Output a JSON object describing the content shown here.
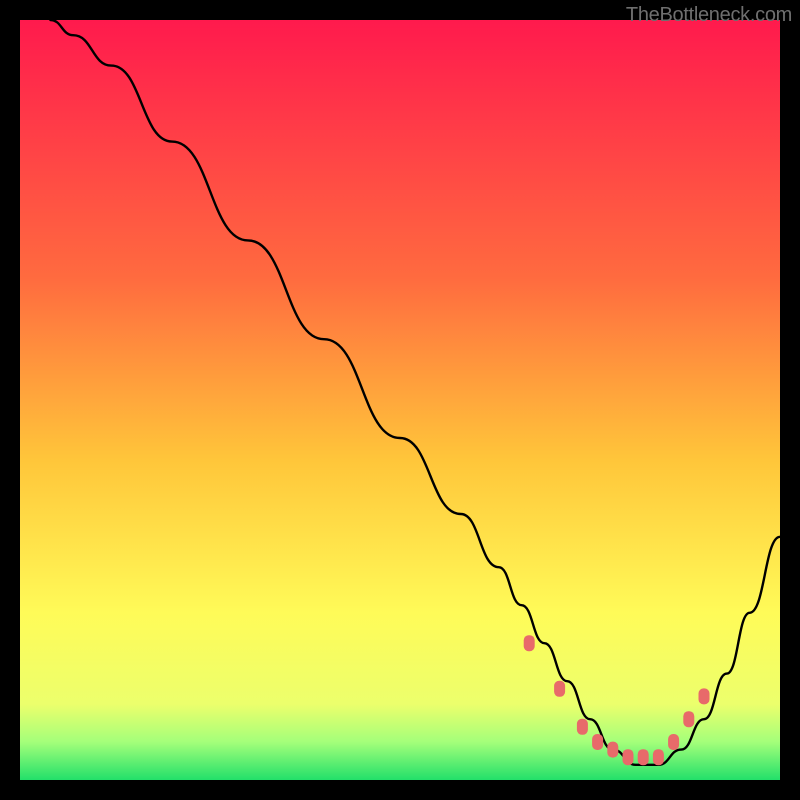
{
  "watermark": "TheBottleneck.com",
  "chart_data": {
    "type": "line",
    "title": "",
    "xlabel": "",
    "ylabel": "",
    "xlim": [
      0,
      100
    ],
    "ylim": [
      0,
      100
    ],
    "gradient_stops": [
      {
        "offset": 0,
        "color": "#ff1a4d"
      },
      {
        "offset": 34,
        "color": "#ff6b3f"
      },
      {
        "offset": 58,
        "color": "#ffc63a"
      },
      {
        "offset": 78,
        "color": "#fffb58"
      },
      {
        "offset": 90,
        "color": "#ecff6c"
      },
      {
        "offset": 95,
        "color": "#a4ff7a"
      },
      {
        "offset": 100,
        "color": "#22e06a"
      }
    ],
    "series": [
      {
        "name": "bottleneck-curve",
        "x": [
          4,
          7,
          12,
          20,
          30,
          40,
          50,
          58,
          63,
          66,
          69,
          72,
          75,
          78,
          81,
          84,
          87,
          90,
          93,
          96,
          100
        ],
        "y": [
          100,
          98,
          94,
          84,
          71,
          58,
          45,
          35,
          28,
          23,
          18,
          13,
          8,
          4,
          2,
          2,
          4,
          8,
          14,
          22,
          32
        ]
      }
    ],
    "markers": {
      "name": "bottleneck-markers",
      "color": "#e86a6a",
      "points": [
        {
          "x": 67,
          "y": 18
        },
        {
          "x": 71,
          "y": 12
        },
        {
          "x": 74,
          "y": 7
        },
        {
          "x": 76,
          "y": 5
        },
        {
          "x": 78,
          "y": 4
        },
        {
          "x": 80,
          "y": 3
        },
        {
          "x": 82,
          "y": 3
        },
        {
          "x": 84,
          "y": 3
        },
        {
          "x": 86,
          "y": 5
        },
        {
          "x": 88,
          "y": 8
        },
        {
          "x": 90,
          "y": 11
        }
      ]
    }
  }
}
